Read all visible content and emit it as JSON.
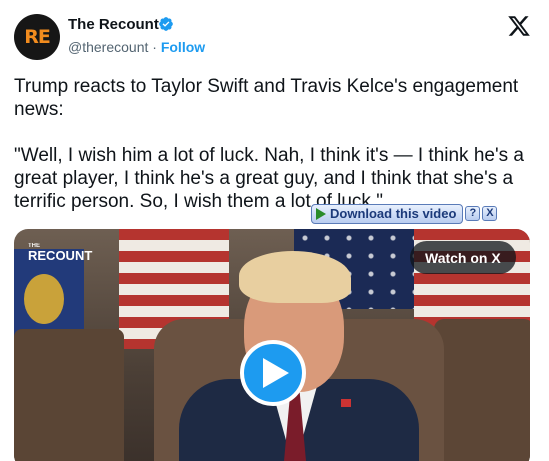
{
  "author": {
    "name": "The Recount",
    "handle": "@therecount",
    "separator": "·",
    "follow_label": "Follow",
    "avatar_text": "RE"
  },
  "tweet": {
    "line1": "Trump reacts to Taylor Swift and Travis Kelce's engagement news:",
    "line2": "\"Well, I wish him a lot of luck. Nah, I think it's — I think he's a great player, I think he's a great guy, and I think that she's a terrific person. So, I wish them a lot of luck.\""
  },
  "media": {
    "watch_label": "Watch on X",
    "logo_small": "THE",
    "logo_text": "RECOUNT"
  },
  "download_bar": {
    "label": "Download this video",
    "help": "?",
    "close": "X"
  },
  "colors": {
    "follow": "#1d9bf0",
    "verified": "#1d9bf0",
    "play_button": "#1d9bf0",
    "avatar_accent": "#f28c1e"
  },
  "icons": {
    "verified": "verified-badge-icon",
    "x_logo": "x-logo-icon",
    "play": "play-icon"
  }
}
